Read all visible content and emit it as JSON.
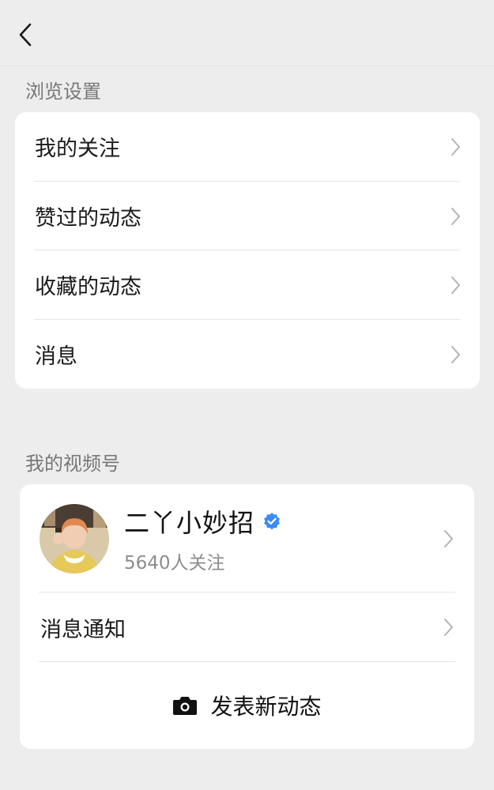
{
  "header": {
    "back_icon": "chevron-left-icon"
  },
  "browse_settings": {
    "title": "浏览设置",
    "items": [
      {
        "label": "我的关注",
        "icon": "chevron-right-icon"
      },
      {
        "label": "赞过的动态",
        "icon": "chevron-right-icon"
      },
      {
        "label": "收藏的动态",
        "icon": "chevron-right-icon"
      },
      {
        "label": "消息",
        "icon": "chevron-right-icon"
      }
    ]
  },
  "my_channel": {
    "title": "我的视频号",
    "profile": {
      "name": "二丫小妙招",
      "followers": "5640人关注",
      "verified_icon": "verified-badge-icon",
      "verified_color": "#3d8af7"
    },
    "notify_label": "消息通知",
    "post_label": "发表新动态",
    "post_icon": "camera-icon"
  }
}
